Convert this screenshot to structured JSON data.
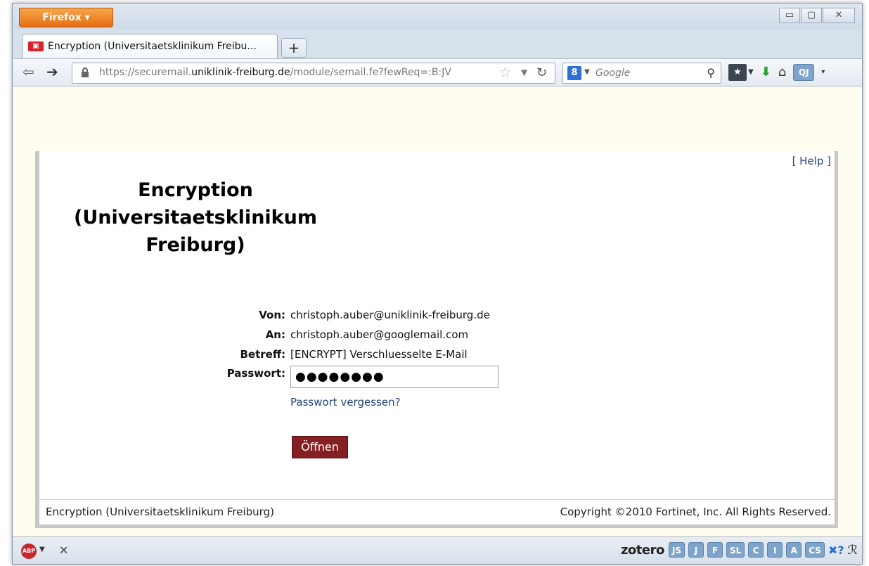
{
  "browser": {
    "app_button": "Firefox ▾",
    "window_controls": {
      "minimize": "▭",
      "maximize": "▢",
      "close": "✕"
    },
    "tab": {
      "title": "Encryption (Universitaetsklinikum Freibu...",
      "favicon": "Fortinet"
    },
    "new_tab": "+",
    "url": {
      "prefix": "https://securemail.",
      "domain": "uniklinik-freiburg.de",
      "path": "/module/semail.fe?fewReq=:B:JV"
    },
    "search": {
      "engine_icon": "8",
      "placeholder": "Google"
    },
    "toolbar_icons": [
      "bookmarks-icon",
      "download-icon",
      "home-icon",
      "qj-icon"
    ],
    "qj_label": "QJ"
  },
  "page": {
    "help": "[ Help ]",
    "title_lines": [
      "Encryption",
      "(Universitaetsklinikum",
      "Freiburg)"
    ],
    "fields": [
      {
        "label": "Von:",
        "value": "christoph.auber@uniklinik-freiburg.de"
      },
      {
        "label": "An:",
        "value": "christoph.auber@googlemail.com"
      },
      {
        "label": "Betreff:",
        "value": "[ENCRYPT] Verschluesselte E-Mail"
      }
    ],
    "password_label": "Passwort:",
    "password_value": "●●●●●●●●",
    "forgot_link": "Passwort vergessen?",
    "open_button": "Öffnen",
    "footer_left": "Encryption (Universitaetsklinikum Freiburg)",
    "footer_right": "Copyright ©2010 Fortinet, Inc. All Rights Reserved."
  },
  "statusbar": {
    "abp": "ABP",
    "zotero": "zotero",
    "buttons": [
      "JS",
      "J",
      "F",
      "SL",
      "C",
      "I",
      "A",
      "CS"
    ]
  },
  "colors": {
    "firefox_orange": "#e46f12",
    "button_maroon": "#842024",
    "link_blue": "#224477",
    "page_bg": "#fffdf0"
  }
}
